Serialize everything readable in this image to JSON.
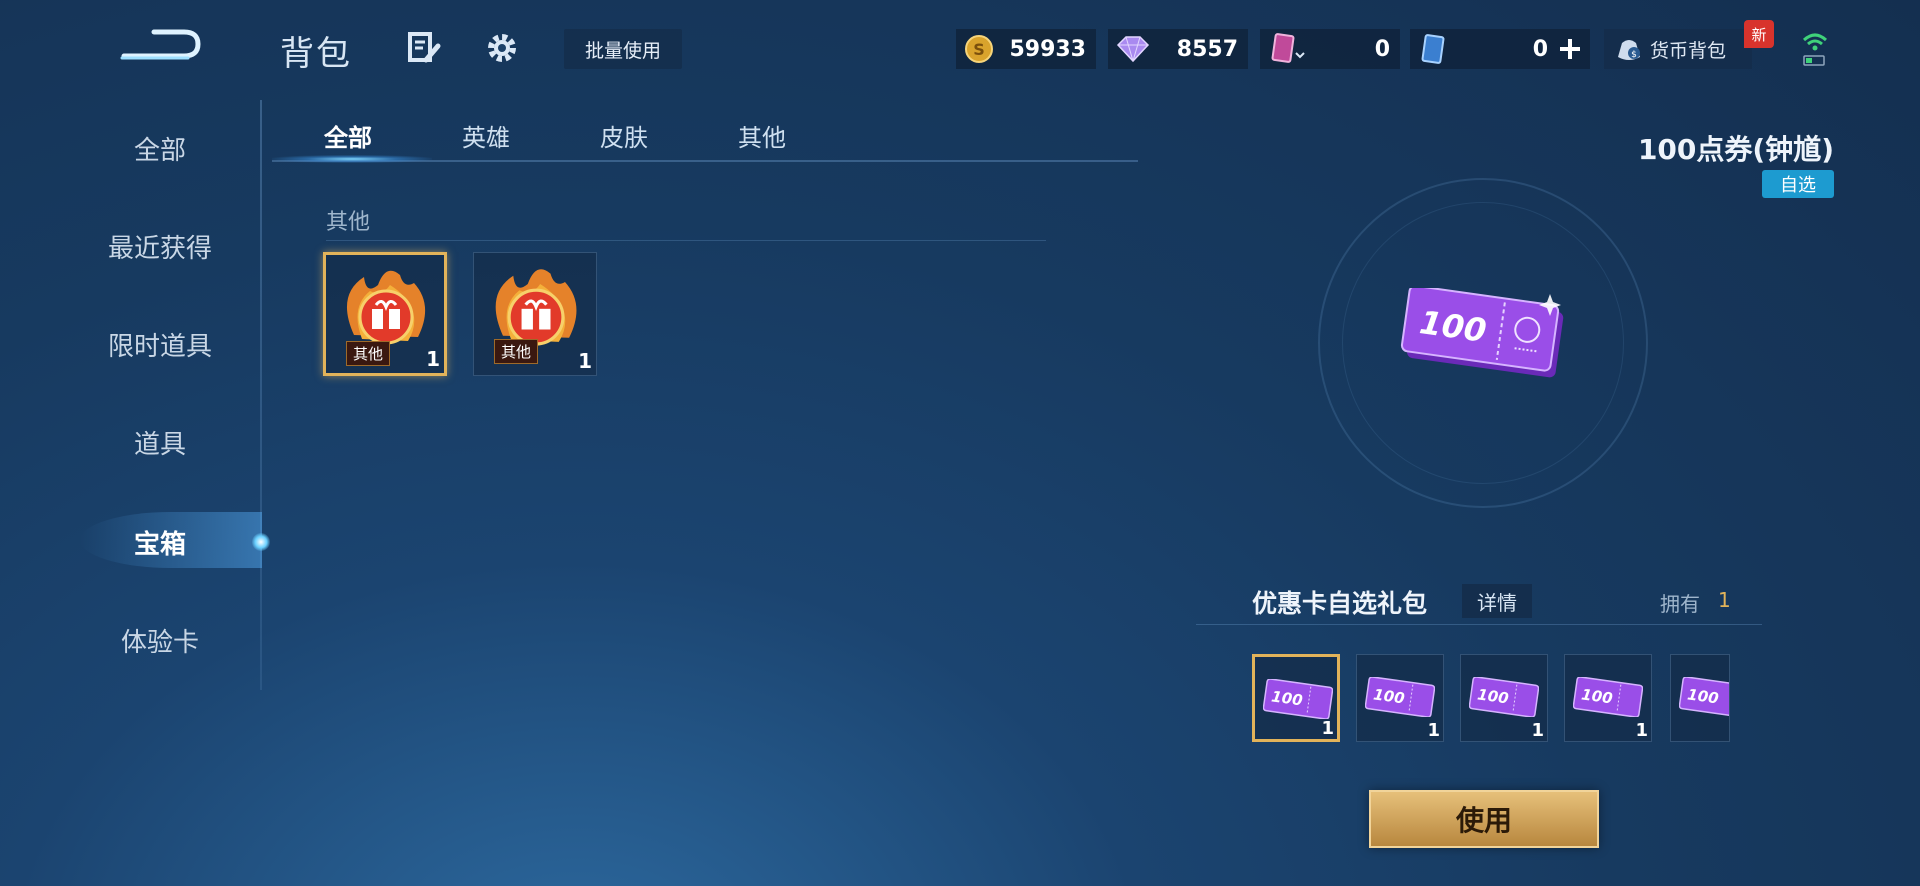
{
  "header": {
    "title": "背包",
    "batch_use": "批量使用",
    "currencies": [
      {
        "name": "coin-icon",
        "value": "59933"
      },
      {
        "name": "diamond-icon",
        "value": "8557"
      },
      {
        "name": "card-icon",
        "value": "0"
      },
      {
        "name": "voucher-icon",
        "value": "0"
      }
    ],
    "wallet_label": "货币背包",
    "new_badge": "新"
  },
  "sidebar": {
    "items": [
      {
        "label": "全部"
      },
      {
        "label": "最近获得"
      },
      {
        "label": "限时道具"
      },
      {
        "label": "道具"
      },
      {
        "label": "宝箱"
      },
      {
        "label": "体验卡"
      }
    ],
    "active_index": 4
  },
  "tabs": [
    {
      "label": "全部"
    },
    {
      "label": "英雄"
    },
    {
      "label": "皮肤"
    },
    {
      "label": "其他"
    }
  ],
  "section": {
    "label": "其他",
    "items": [
      {
        "tag": "其他",
        "count": "1"
      },
      {
        "tag": "其他",
        "count": "1"
      }
    ]
  },
  "detail": {
    "title": "100点券(钟馗)",
    "badge": "自选",
    "ticket_value": "100",
    "pack_title": "优惠卡自选礼包",
    "detail_link": "详情",
    "own_label": "拥有",
    "own_value": "1",
    "options": [
      {
        "label": "100",
        "count": "1"
      },
      {
        "label": "100",
        "count": "1"
      },
      {
        "label": "100",
        "count": "1"
      },
      {
        "label": "100",
        "count": "1"
      },
      {
        "label": "100",
        "count": ""
      }
    ],
    "use_button": "使用"
  },
  "colors": {
    "accent_gold": "#e2b35a",
    "badge_blue": "#1d9bd0",
    "ticket_purple": "#8a3ad8"
  }
}
